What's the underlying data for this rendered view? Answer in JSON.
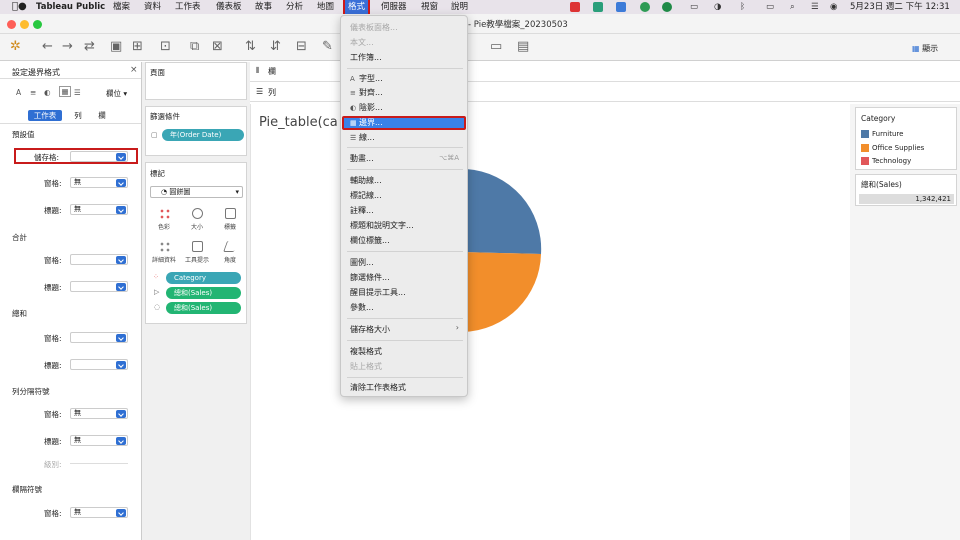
{
  "menubar": {
    "apple": "",
    "app": "Tableau Public",
    "items": [
      "檔案",
      "資料",
      "工作表",
      "儀表板",
      "故事",
      "分析",
      "地圖",
      "格式",
      "伺服器",
      "視窗",
      "說明"
    ],
    "clock": "5月23日 週二 下午 12:31"
  },
  "window": {
    "title": "Pie教學檔案_20230503",
    "show_me": "顯示"
  },
  "format_pane": {
    "title": "設定邊界格式",
    "tabs": [
      "工作表",
      "列",
      "欄"
    ],
    "fields_label": "欄位",
    "sections": [
      {
        "heading": "預設值",
        "rows": [
          {
            "label": "儲存格:",
            "value": ""
          },
          {
            "label": "窗格:",
            "value": "無"
          },
          {
            "label": "標題:",
            "value": "無"
          }
        ]
      },
      {
        "heading": "合計",
        "rows": [
          {
            "label": "窗格:",
            "value": ""
          },
          {
            "label": "標題:",
            "value": ""
          }
        ]
      },
      {
        "heading": "總和",
        "rows": [
          {
            "label": "窗格:",
            "value": ""
          },
          {
            "label": "標題:",
            "value": ""
          }
        ]
      },
      {
        "heading": "列分隔符號",
        "rows": [
          {
            "label": "窗格:",
            "value": "無"
          },
          {
            "label": "標題:",
            "value": "無"
          },
          {
            "label": "級別:",
            "value": ""
          }
        ]
      },
      {
        "heading": "欄隔符號",
        "rows": [
          {
            "label": "窗格:",
            "value": "無"
          }
        ]
      }
    ]
  },
  "pages": {
    "title": "頁面"
  },
  "filters": {
    "title": "篩選條件",
    "pill": "年(Order Date)"
  },
  "marks": {
    "title": "標記",
    "type": "圓餅圖",
    "buttons": [
      "色彩",
      "大小",
      "標籤",
      "詳細資料",
      "工具提示",
      "角度"
    ],
    "pills": [
      {
        "label": "Category",
        "color": "#3aa6b5"
      },
      {
        "label": "總和(Sales)",
        "color": "#22b573"
      },
      {
        "label": "總和(Sales)",
        "color": "#22b573"
      }
    ]
  },
  "shelves": {
    "columns": "欄",
    "rows": "列"
  },
  "sheet_title": "Pie_table(ca",
  "legend": {
    "title": "Category",
    "items": [
      {
        "label": "Furniture",
        "color": "#4e79a7"
      },
      {
        "label": "Office Supplies",
        "color": "#f28e2b"
      },
      {
        "label": "Technology",
        "color": "#e15759"
      }
    ]
  },
  "size_legend": {
    "title": "總和(Sales)",
    "value": "1,342,421"
  },
  "menu": {
    "items": [
      {
        "label": "儀表板面格...",
        "disabled": true,
        "icon": ""
      },
      {
        "label": "本文...",
        "disabled": true,
        "icon": ""
      },
      {
        "label": "工作簿...",
        "disabled": false,
        "icon": ""
      },
      {
        "sep": true
      },
      {
        "label": "字型...",
        "disabled": false,
        "icon": "A"
      },
      {
        "label": "對齊...",
        "disabled": false,
        "icon": "≡"
      },
      {
        "label": "陰影...",
        "disabled": false,
        "icon": "◐"
      },
      {
        "label": "邊界...",
        "disabled": false,
        "icon": "▦",
        "highlight": true
      },
      {
        "label": "線...",
        "disabled": false,
        "icon": "☰"
      },
      {
        "sep": true
      },
      {
        "label": "動畫...",
        "disabled": false,
        "icon": "",
        "shortcut": "⌥⌘A"
      },
      {
        "sep": true
      },
      {
        "label": "輔助線...",
        "disabled": false,
        "icon": ""
      },
      {
        "label": "標記線...",
        "disabled": false,
        "icon": ""
      },
      {
        "label": "註釋...",
        "disabled": false,
        "icon": ""
      },
      {
        "label": "標題和說明文字...",
        "disabled": false,
        "icon": ""
      },
      {
        "label": "欄位標籤...",
        "disabled": false,
        "icon": ""
      },
      {
        "sep": true
      },
      {
        "label": "圖例...",
        "disabled": false,
        "icon": ""
      },
      {
        "label": "篩選條件...",
        "disabled": false,
        "icon": ""
      },
      {
        "label": "醒目提示工具...",
        "disabled": false,
        "icon": ""
      },
      {
        "label": "參數...",
        "disabled": false,
        "icon": ""
      },
      {
        "sep": true
      },
      {
        "label": "儲存格大小",
        "disabled": false,
        "icon": "",
        "submenu": true
      },
      {
        "sep": true
      },
      {
        "label": "複製格式",
        "disabled": false,
        "icon": ""
      },
      {
        "label": "貼上格式",
        "disabled": true,
        "icon": ""
      },
      {
        "sep": true
      },
      {
        "label": "清除工作表格式",
        "disabled": false,
        "icon": ""
      }
    ]
  }
}
